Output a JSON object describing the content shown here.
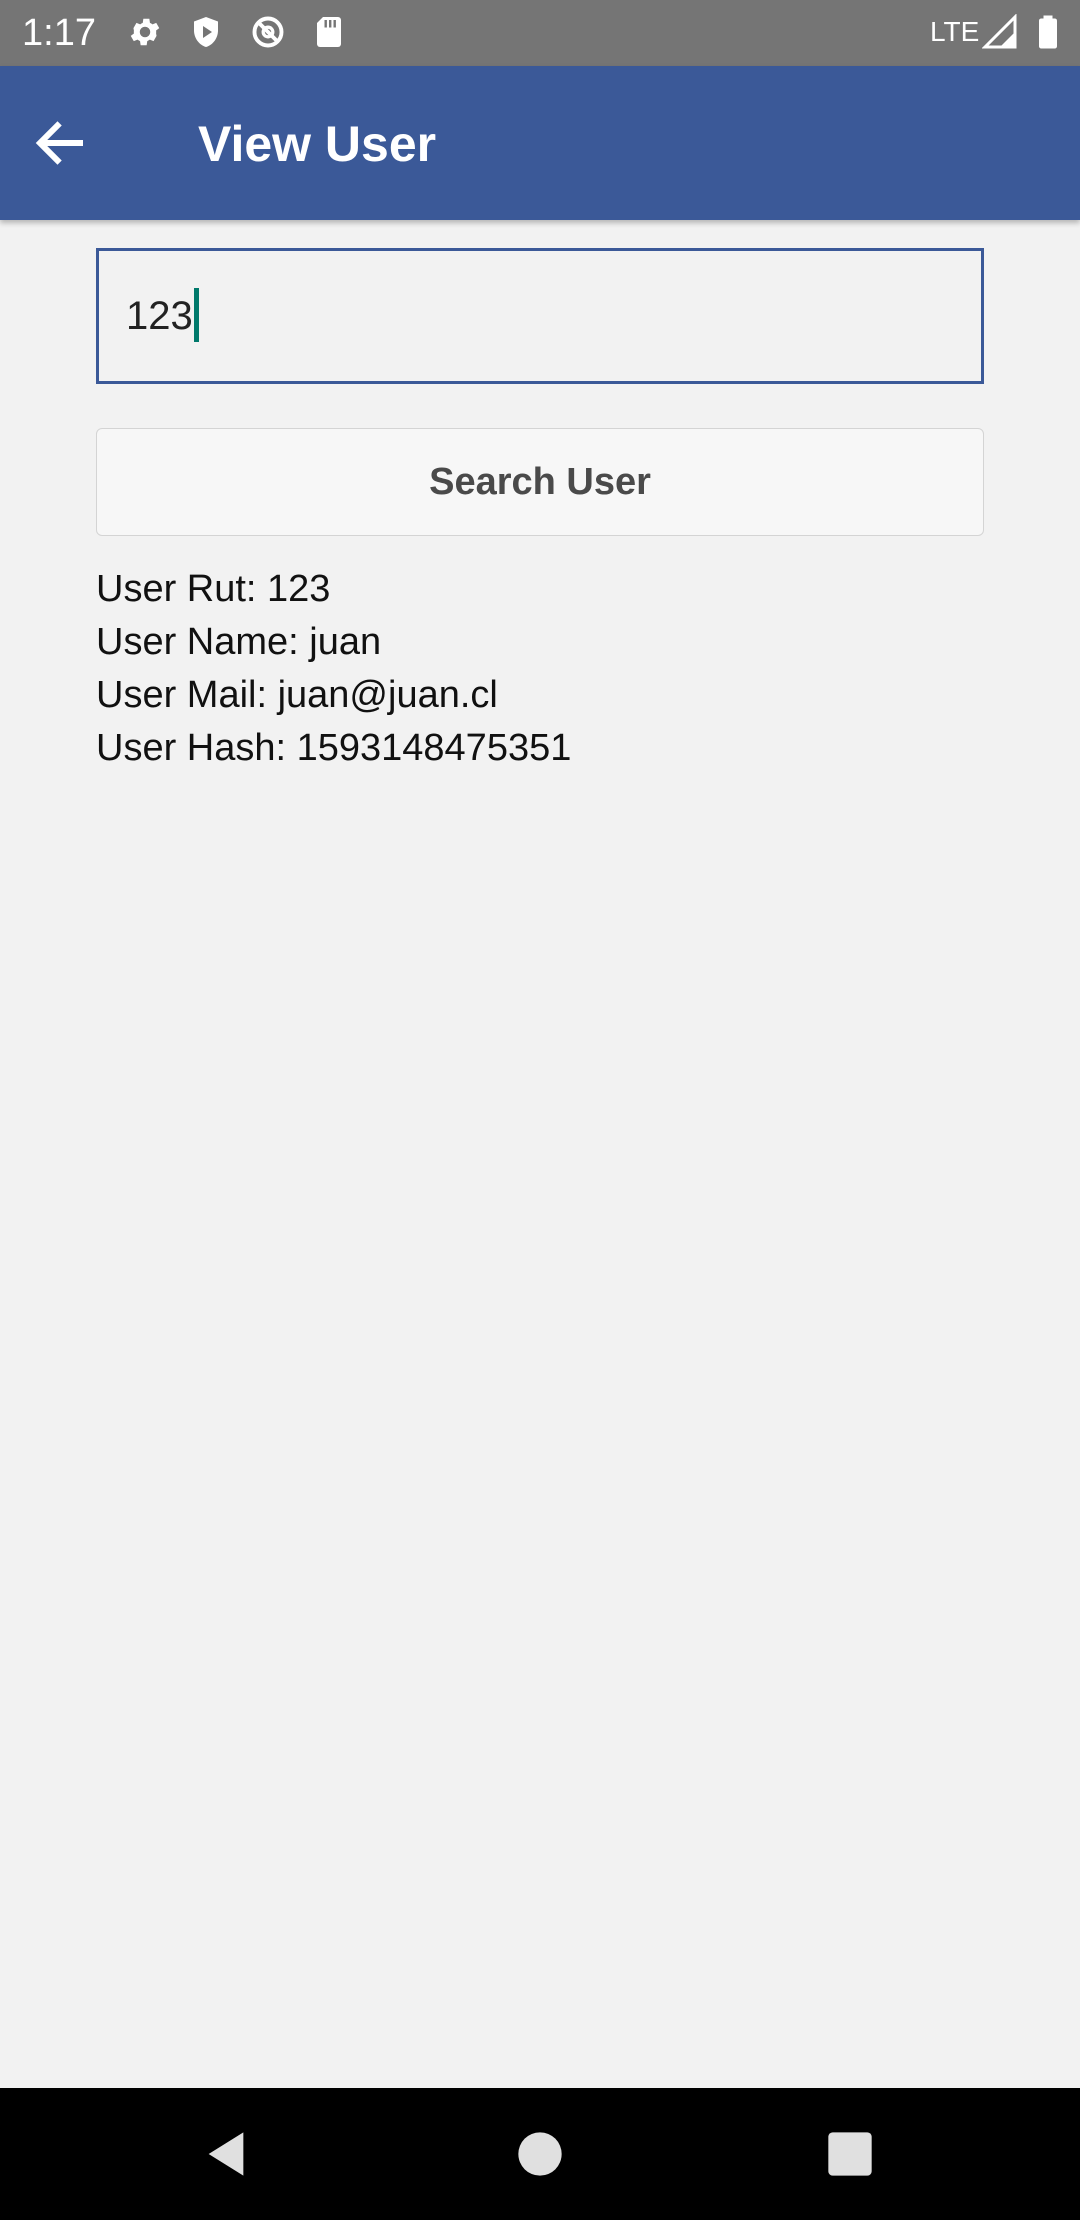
{
  "status_bar": {
    "time": "1:17",
    "network": "LTE",
    "icons": [
      "gear-icon",
      "shield-icon",
      "no-sync-icon",
      "sd-card-icon",
      "signal-icon",
      "battery-icon"
    ]
  },
  "app_bar": {
    "title": "View User",
    "back_icon": "arrow-left-icon",
    "color": "#3b5998"
  },
  "search": {
    "value": "123",
    "button_label": "Search User"
  },
  "user_info": {
    "rut": "User Rut: 123",
    "name": "User Name: juan",
    "mail": "User Mail: juan@juan.cl",
    "hash": "User Hash: 1593148475351"
  },
  "nav_bar": {
    "icons": [
      "back-triangle-icon",
      "home-circle-icon",
      "recents-square-icon"
    ]
  }
}
